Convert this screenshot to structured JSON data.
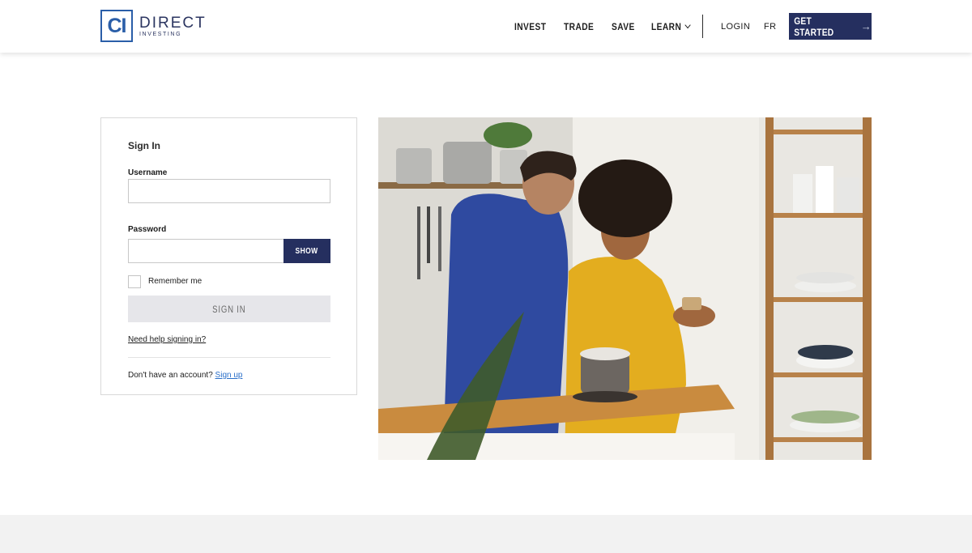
{
  "header": {
    "logo": {
      "mark": "CI",
      "name": "DIRECT",
      "tagline": "INVESTING"
    },
    "nav": [
      {
        "label": "INVEST"
      },
      {
        "label": "TRADE"
      },
      {
        "label": "SAVE"
      },
      {
        "label": "LEARN",
        "icon": "chevron-down-icon"
      }
    ],
    "login_label": "LOGIN",
    "language_label": "FR",
    "cta": {
      "label": "GET STARTED",
      "icon": "arrow-right-icon"
    }
  },
  "signin": {
    "title": "Sign In",
    "username_label": "Username",
    "username_value": "",
    "password_label": "Password",
    "password_value": "",
    "show_label": "SHOW",
    "remember_label": "Remember me",
    "remember_checked": false,
    "submit_label": "SIGN IN",
    "help_link": "Need help signing in?",
    "no_account_text": "Don't have an account?",
    "signup_link": "Sign up"
  },
  "colors": {
    "brand_navy": "#252f5f",
    "logo_blue": "#2a5ea8",
    "link_blue": "#2a6fc9",
    "disabled_button": "#e6e6ea",
    "footer_band": "#f2f2f2"
  }
}
